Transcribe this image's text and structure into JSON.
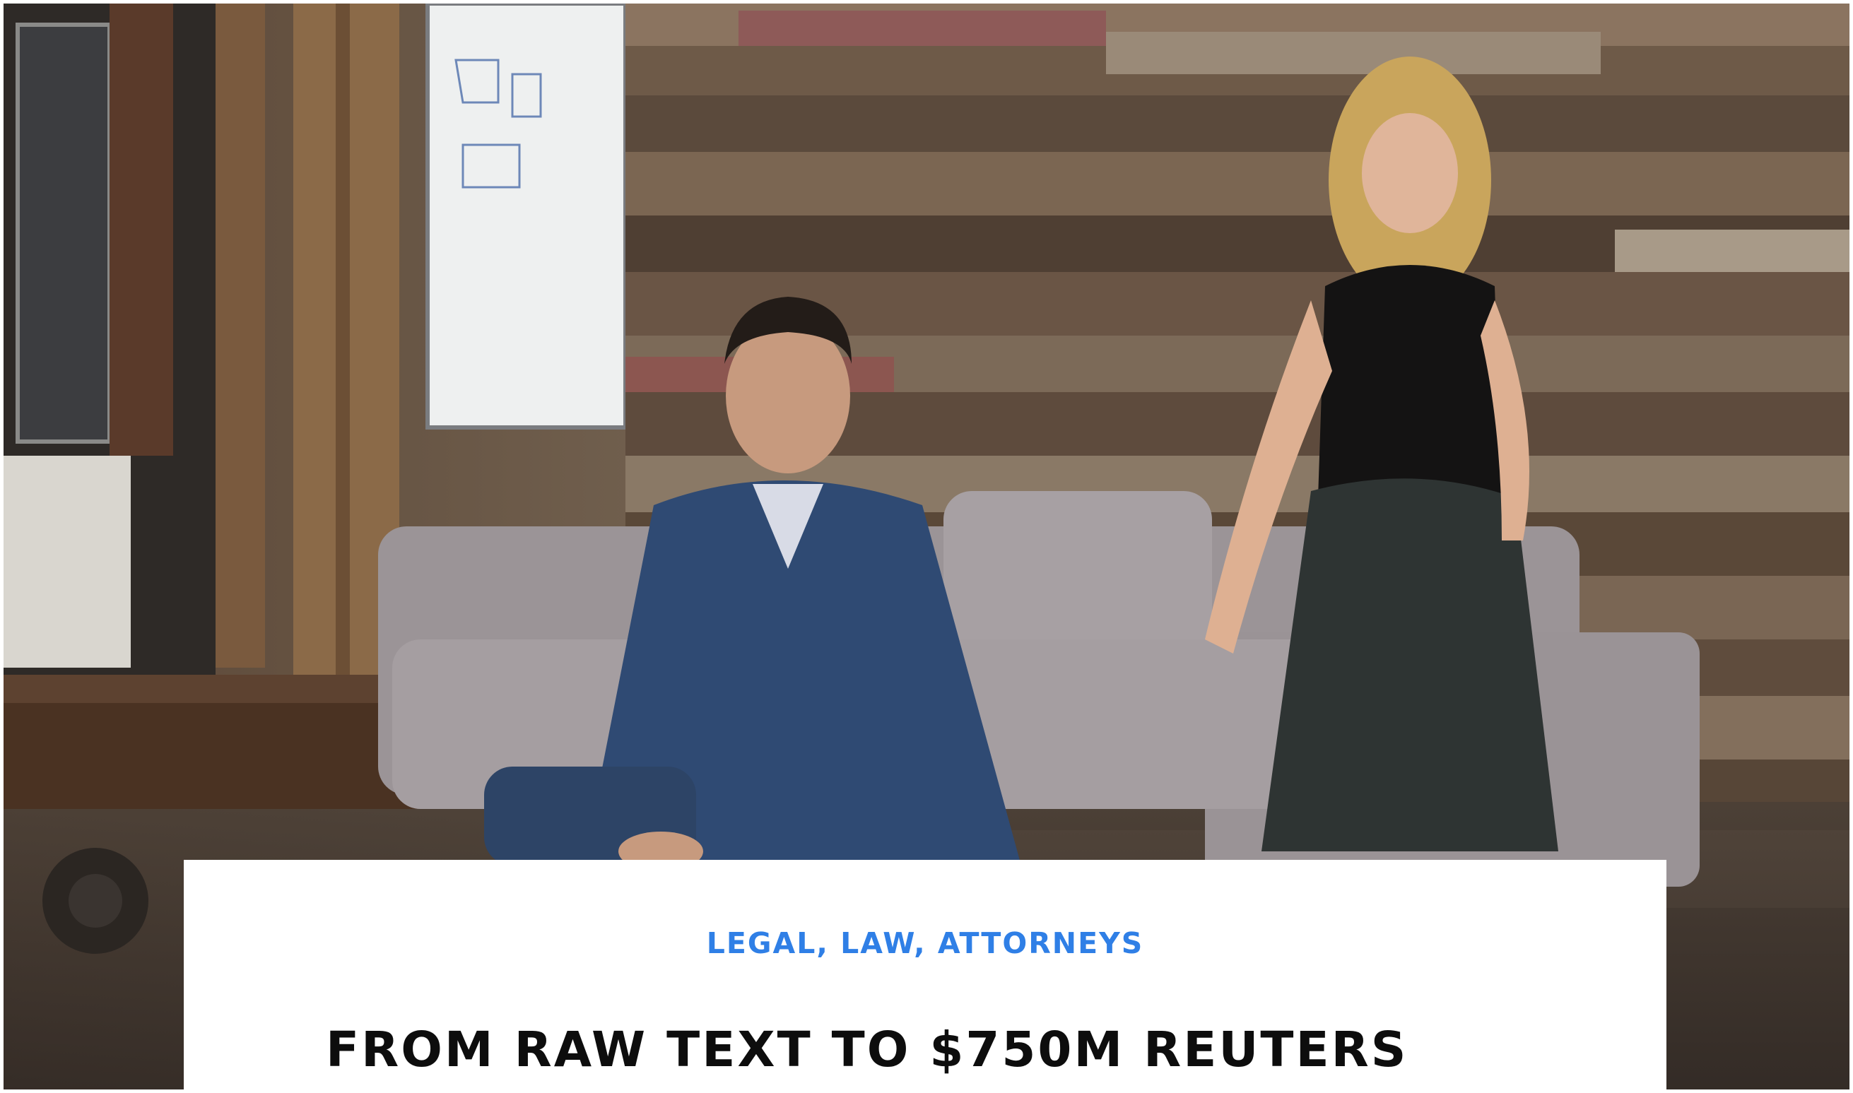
{
  "article": {
    "category": "LEGAL, LAW, ATTORNEYS",
    "title": "FROM RAW TEXT TO $750M REUTERS"
  },
  "colors": {
    "category": "#2f7fe6",
    "title": "#0d0d0d",
    "card_background": "#ffffff"
  }
}
